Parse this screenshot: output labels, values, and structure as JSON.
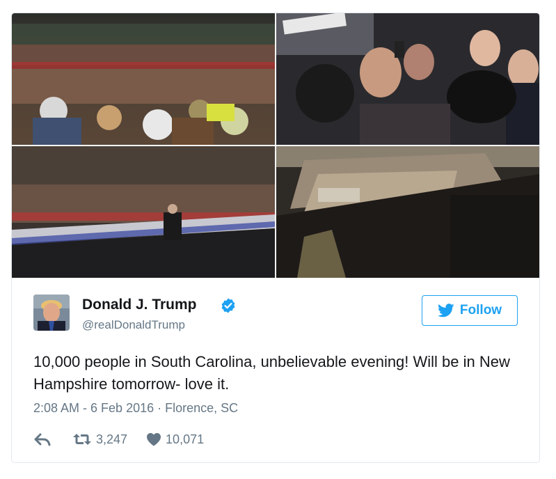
{
  "photos": [
    {
      "name": "arena-crowd-photo"
    },
    {
      "name": "selfie-crowd-photo"
    },
    {
      "name": "stage-speaker-photo"
    },
    {
      "name": "arena-overview-photo"
    }
  ],
  "user": {
    "display_name": "Donald J. Trump",
    "handle": "@realDonaldTrump",
    "verified": true
  },
  "follow_button": {
    "label": "Follow"
  },
  "tweet": {
    "text": "10,000 people in South Carolina, unbelievable evening! Will be in New Hampshire tomorrow- love it.",
    "timestamp": "2:08 AM - 6 Feb 2016",
    "separator": " · ",
    "location": "Florence, SC"
  },
  "actions": {
    "retweets": "3,247",
    "likes": "10,071"
  },
  "colors": {
    "accent": "#1da1f2",
    "secondary_text": "#657786",
    "border": "#e1e8ed"
  }
}
